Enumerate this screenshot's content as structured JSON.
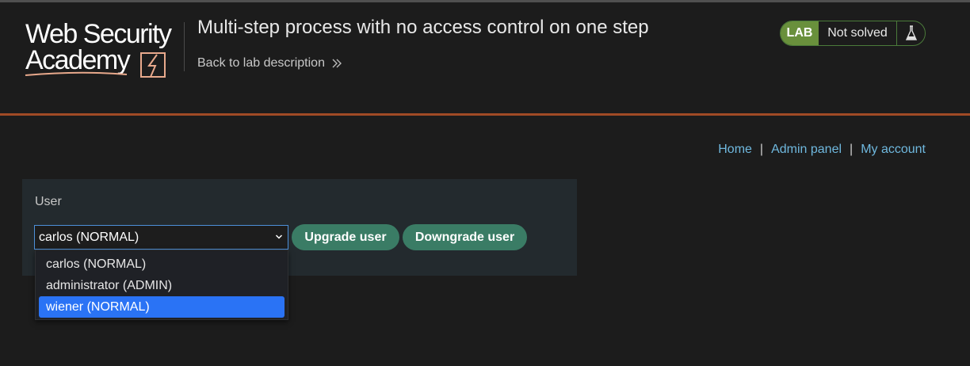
{
  "header": {
    "logo_line1": "Web Security",
    "logo_line2": "Academy",
    "lab_title": "Multi-step process with no access control on one step",
    "back_link": "Back to lab description",
    "status": {
      "badge": "LAB",
      "text": "Not solved"
    }
  },
  "nav": {
    "home": "Home",
    "admin_panel": "Admin panel",
    "my_account": "My account",
    "separator": "|"
  },
  "panel": {
    "label": "User",
    "selected_value": "carlos (NORMAL)",
    "upgrade_label": "Upgrade user",
    "downgrade_label": "Downgrade user"
  },
  "dropdown": {
    "options": [
      "carlos (NORMAL)",
      "administrator (ADMIN)",
      "wiener (NORMAL)"
    ],
    "highlighted_index": 2
  },
  "colors": {
    "accent_orange": "#a04a25",
    "lab_green": "#69903c",
    "button_green": "#3a7c65",
    "link_blue": "#6fb8de",
    "highlight_blue": "#2a73f5"
  },
  "icons": {
    "logo_bolt": "lightning-icon",
    "back_chevron": "double-chevron-right-icon",
    "status_flask": "flask-icon",
    "select_caret": "chevron-down-icon"
  }
}
